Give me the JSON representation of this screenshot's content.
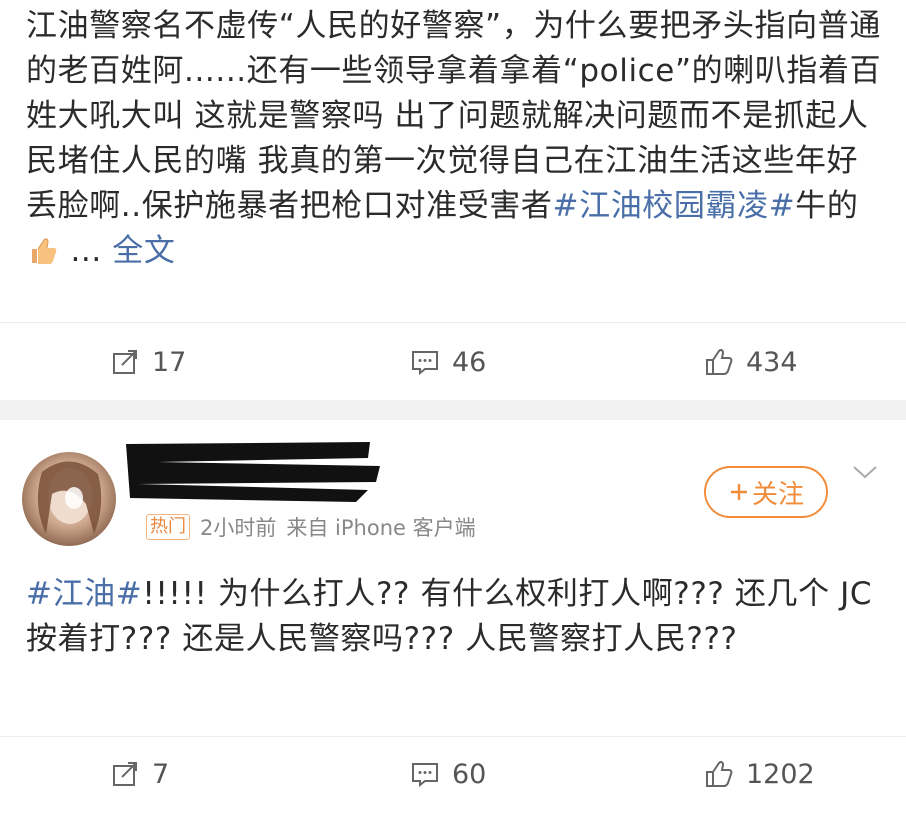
{
  "post1": {
    "text_before_tag": "江油警察名不虚传“人民的好警察”，为什么要把矛头指向普通的老百姓阿......还有一些领导拿着拿着“police”的喇叭指着百姓大吼大叫 这就是警察吗 出了问题就解决问题而不是抓起人民堵住人民的嘴 我真的第一次觉得自己在江油生活这些年好丢脸啊..保护施暴者把枪口对准受害者",
    "hashtag": "#江油校园霸凌#",
    "text_after_tag": "牛的",
    "ellipsis": " ... ",
    "more_link": "全文",
    "actions": {
      "repost_count": "17",
      "comment_count": "46",
      "like_count": "434"
    }
  },
  "post2": {
    "hot_badge": "热门",
    "time": "2小时前",
    "source": "来自 iPhone 客户端",
    "follow_label": "关注",
    "hashtag": "#江油#",
    "text": "!!!!! 为什么打人?? 有什么权利打人啊??? 还几个 JC按着打??? 还是人民警察吗??? 人民警察打人民???",
    "actions": {
      "repost_count": "7",
      "comment_count": "60",
      "like_count": "1202"
    }
  },
  "colors": {
    "link": "#4a6fa8",
    "accent_orange": "#f08c3a",
    "text": "#2b2b2b",
    "meta": "#888888"
  },
  "icons": [
    "repost-icon",
    "comment-icon",
    "like-icon",
    "thumbs-up-emoji",
    "chevron-down-icon",
    "plus-icon"
  ]
}
